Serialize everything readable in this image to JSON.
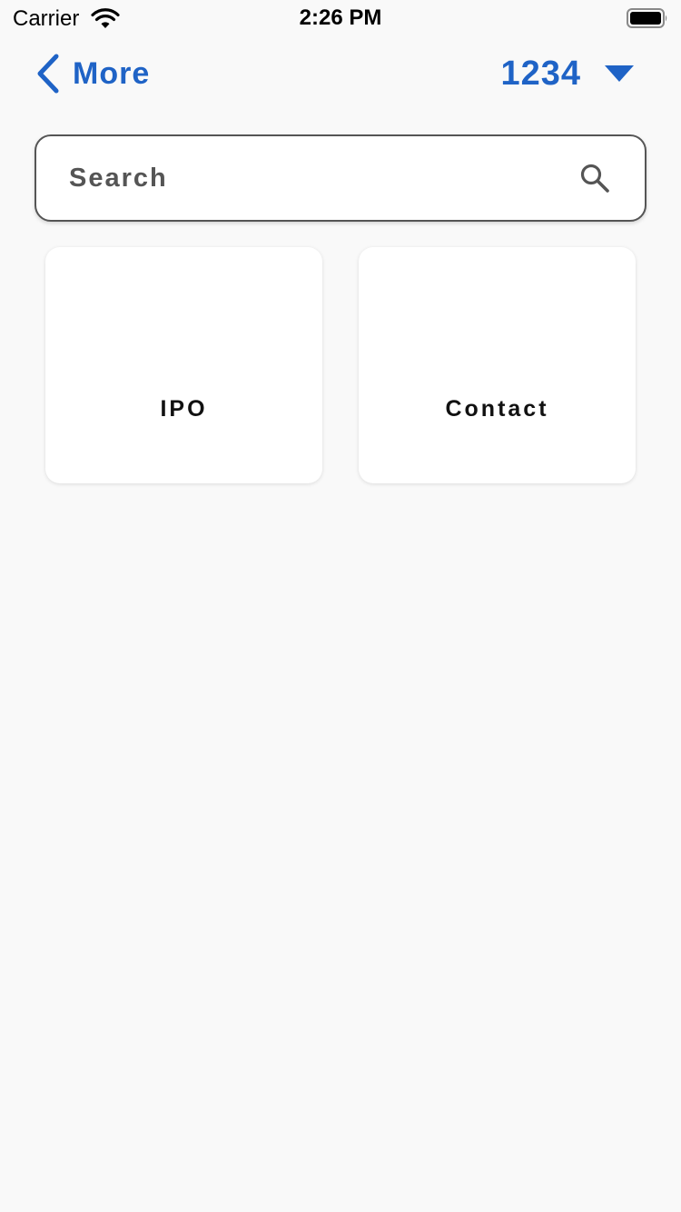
{
  "status_bar": {
    "carrier": "Carrier",
    "time": "2:26 PM"
  },
  "nav": {
    "back_label": "More",
    "account_number": "1234"
  },
  "search": {
    "placeholder": "Search"
  },
  "tiles": [
    {
      "label": "IPO"
    },
    {
      "label": "Contact"
    }
  ],
  "colors": {
    "accent": "#1f63c6",
    "background": "#f9f9f9",
    "card": "#ffffff"
  },
  "icons": {
    "back": "chevron-left-icon",
    "account_dropdown": "caret-down-icon",
    "search": "search-icon",
    "wifi": "wifi-icon",
    "battery": "battery-icon"
  }
}
